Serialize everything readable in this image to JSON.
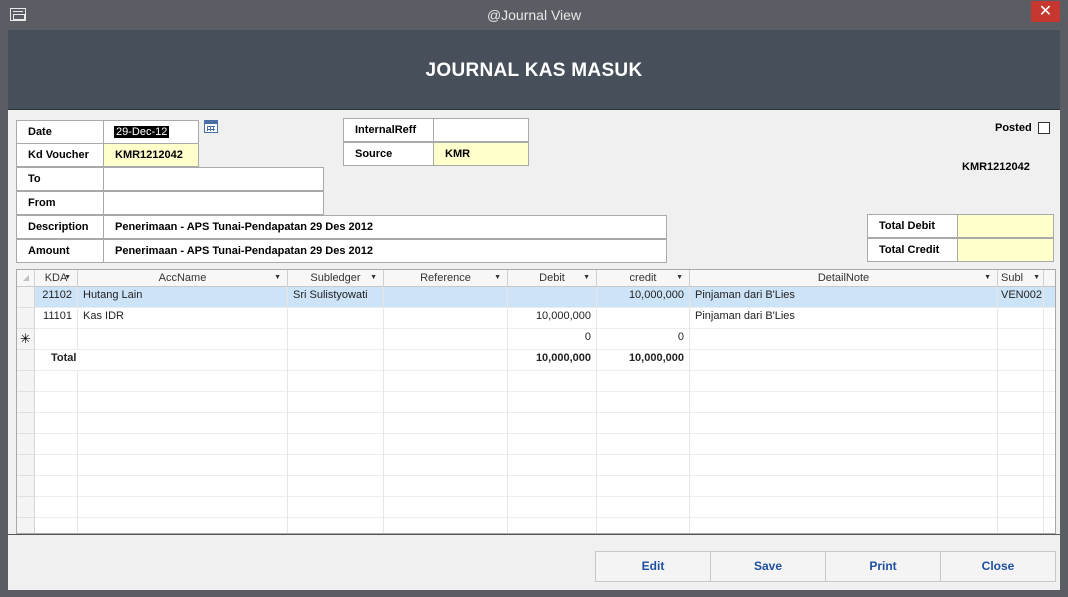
{
  "window": {
    "title": "@Journal View",
    "close_glyph": "✕"
  },
  "header": {
    "title": "JOURNAL KAS MASUK"
  },
  "form": {
    "date_label": "Date",
    "date_value": "29-Dec-12",
    "kd_voucher_label": "Kd Voucher",
    "kd_voucher_value": "KMR1212042",
    "to_label": "To",
    "to_value": "",
    "from_label": "From",
    "from_value": "",
    "description_label": "Description",
    "description_value": "Penerimaan - APS Tunai-Pendapatan 29 Des 2012",
    "amount_label": "Amount",
    "amount_value": "Penerimaan - APS Tunai-Pendapatan 29 Des 2012",
    "internal_reff_label": "InternalReff",
    "internal_reff_value": "",
    "source_label": "Source",
    "source_value": "KMR",
    "posted_label": "Posted",
    "voucher_ref": "KMR1212042",
    "total_debit_label": "Total Debit",
    "total_debit_value": "",
    "total_credit_label": "Total Credit",
    "total_credit_value": ""
  },
  "grid": {
    "columns": [
      "KDA",
      "AccName",
      "Subledger",
      "Reference",
      "Debit",
      "credit",
      "DetailNote",
      "Subl"
    ],
    "rows": [
      {
        "kda": "21102",
        "accname": "Hutang Lain",
        "subledger": "Sri Sulistyowati",
        "reference": "",
        "debit": "",
        "credit": "10,000,000",
        "detailnote": "Pinjaman dari B'Lies",
        "subl": "VEN002"
      },
      {
        "kda": "11101",
        "accname": "Kas IDR",
        "subledger": "",
        "reference": "",
        "debit": "10,000,000",
        "credit": "",
        "detailnote": "Pinjaman dari B'Lies",
        "subl": ""
      }
    ],
    "new_row": {
      "indicator": "✳",
      "debit": "0",
      "credit": "0"
    },
    "total_row": {
      "label": "Total",
      "debit": "10,000,000",
      "credit": "10,000,000"
    }
  },
  "buttons": {
    "edit": "Edit",
    "save": "Save",
    "print": "Print",
    "close": "Close"
  }
}
